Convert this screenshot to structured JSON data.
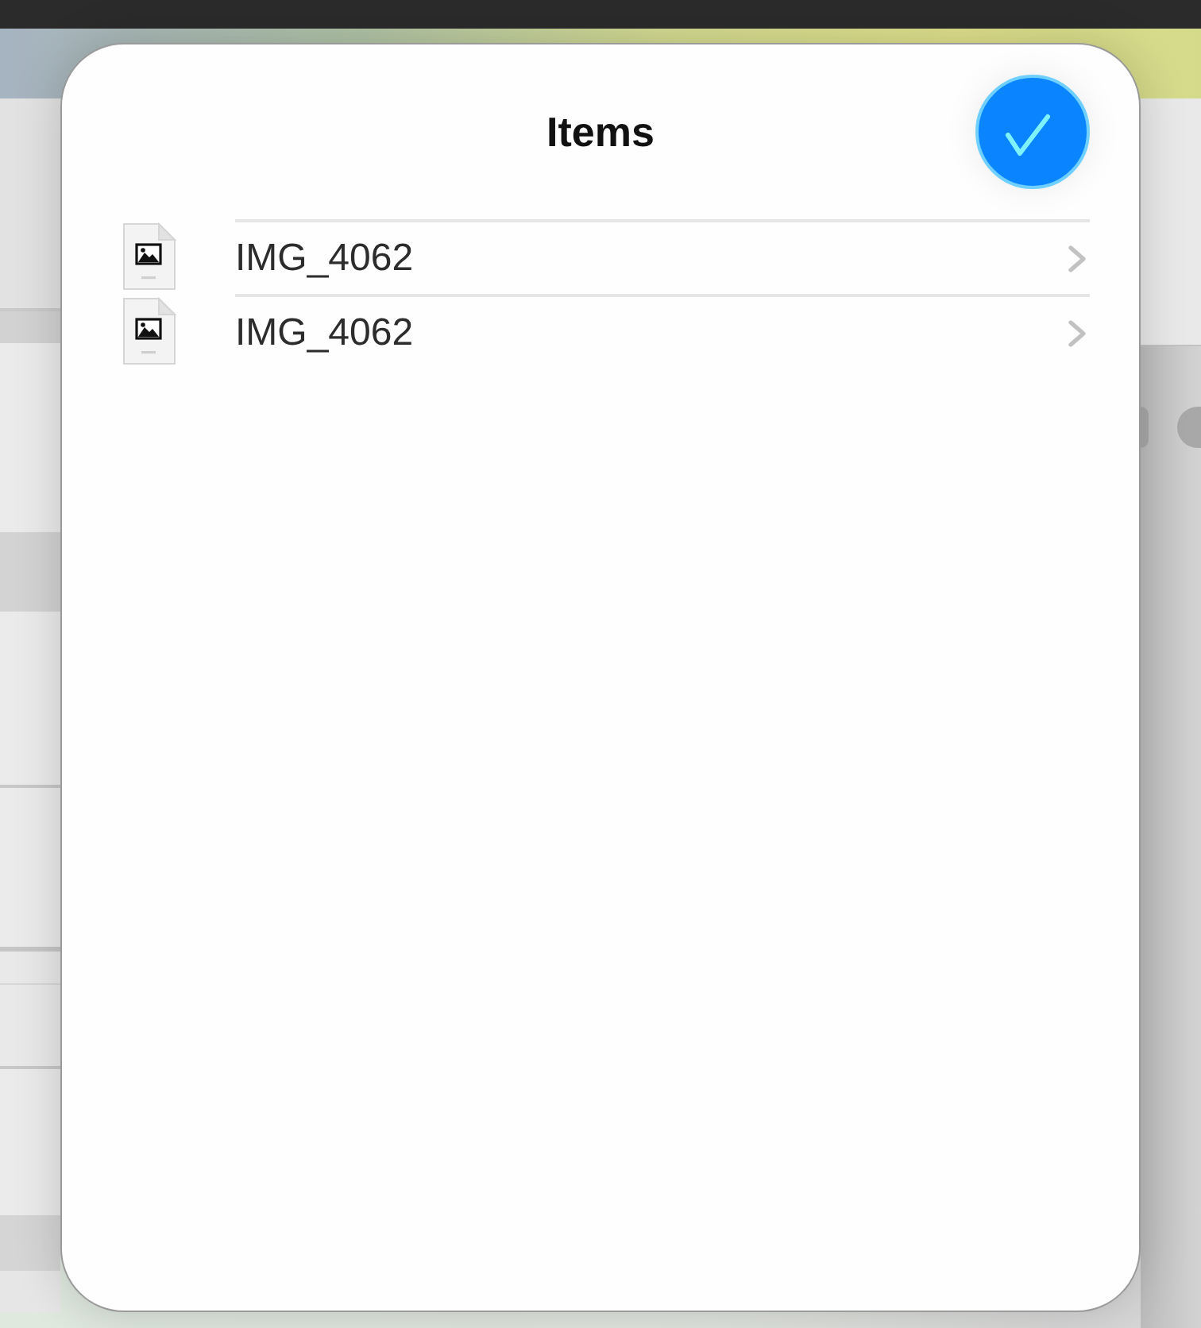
{
  "sheet": {
    "title": "Items"
  },
  "items": [
    {
      "name": "IMG_4062"
    },
    {
      "name": "IMG_4062"
    }
  ]
}
